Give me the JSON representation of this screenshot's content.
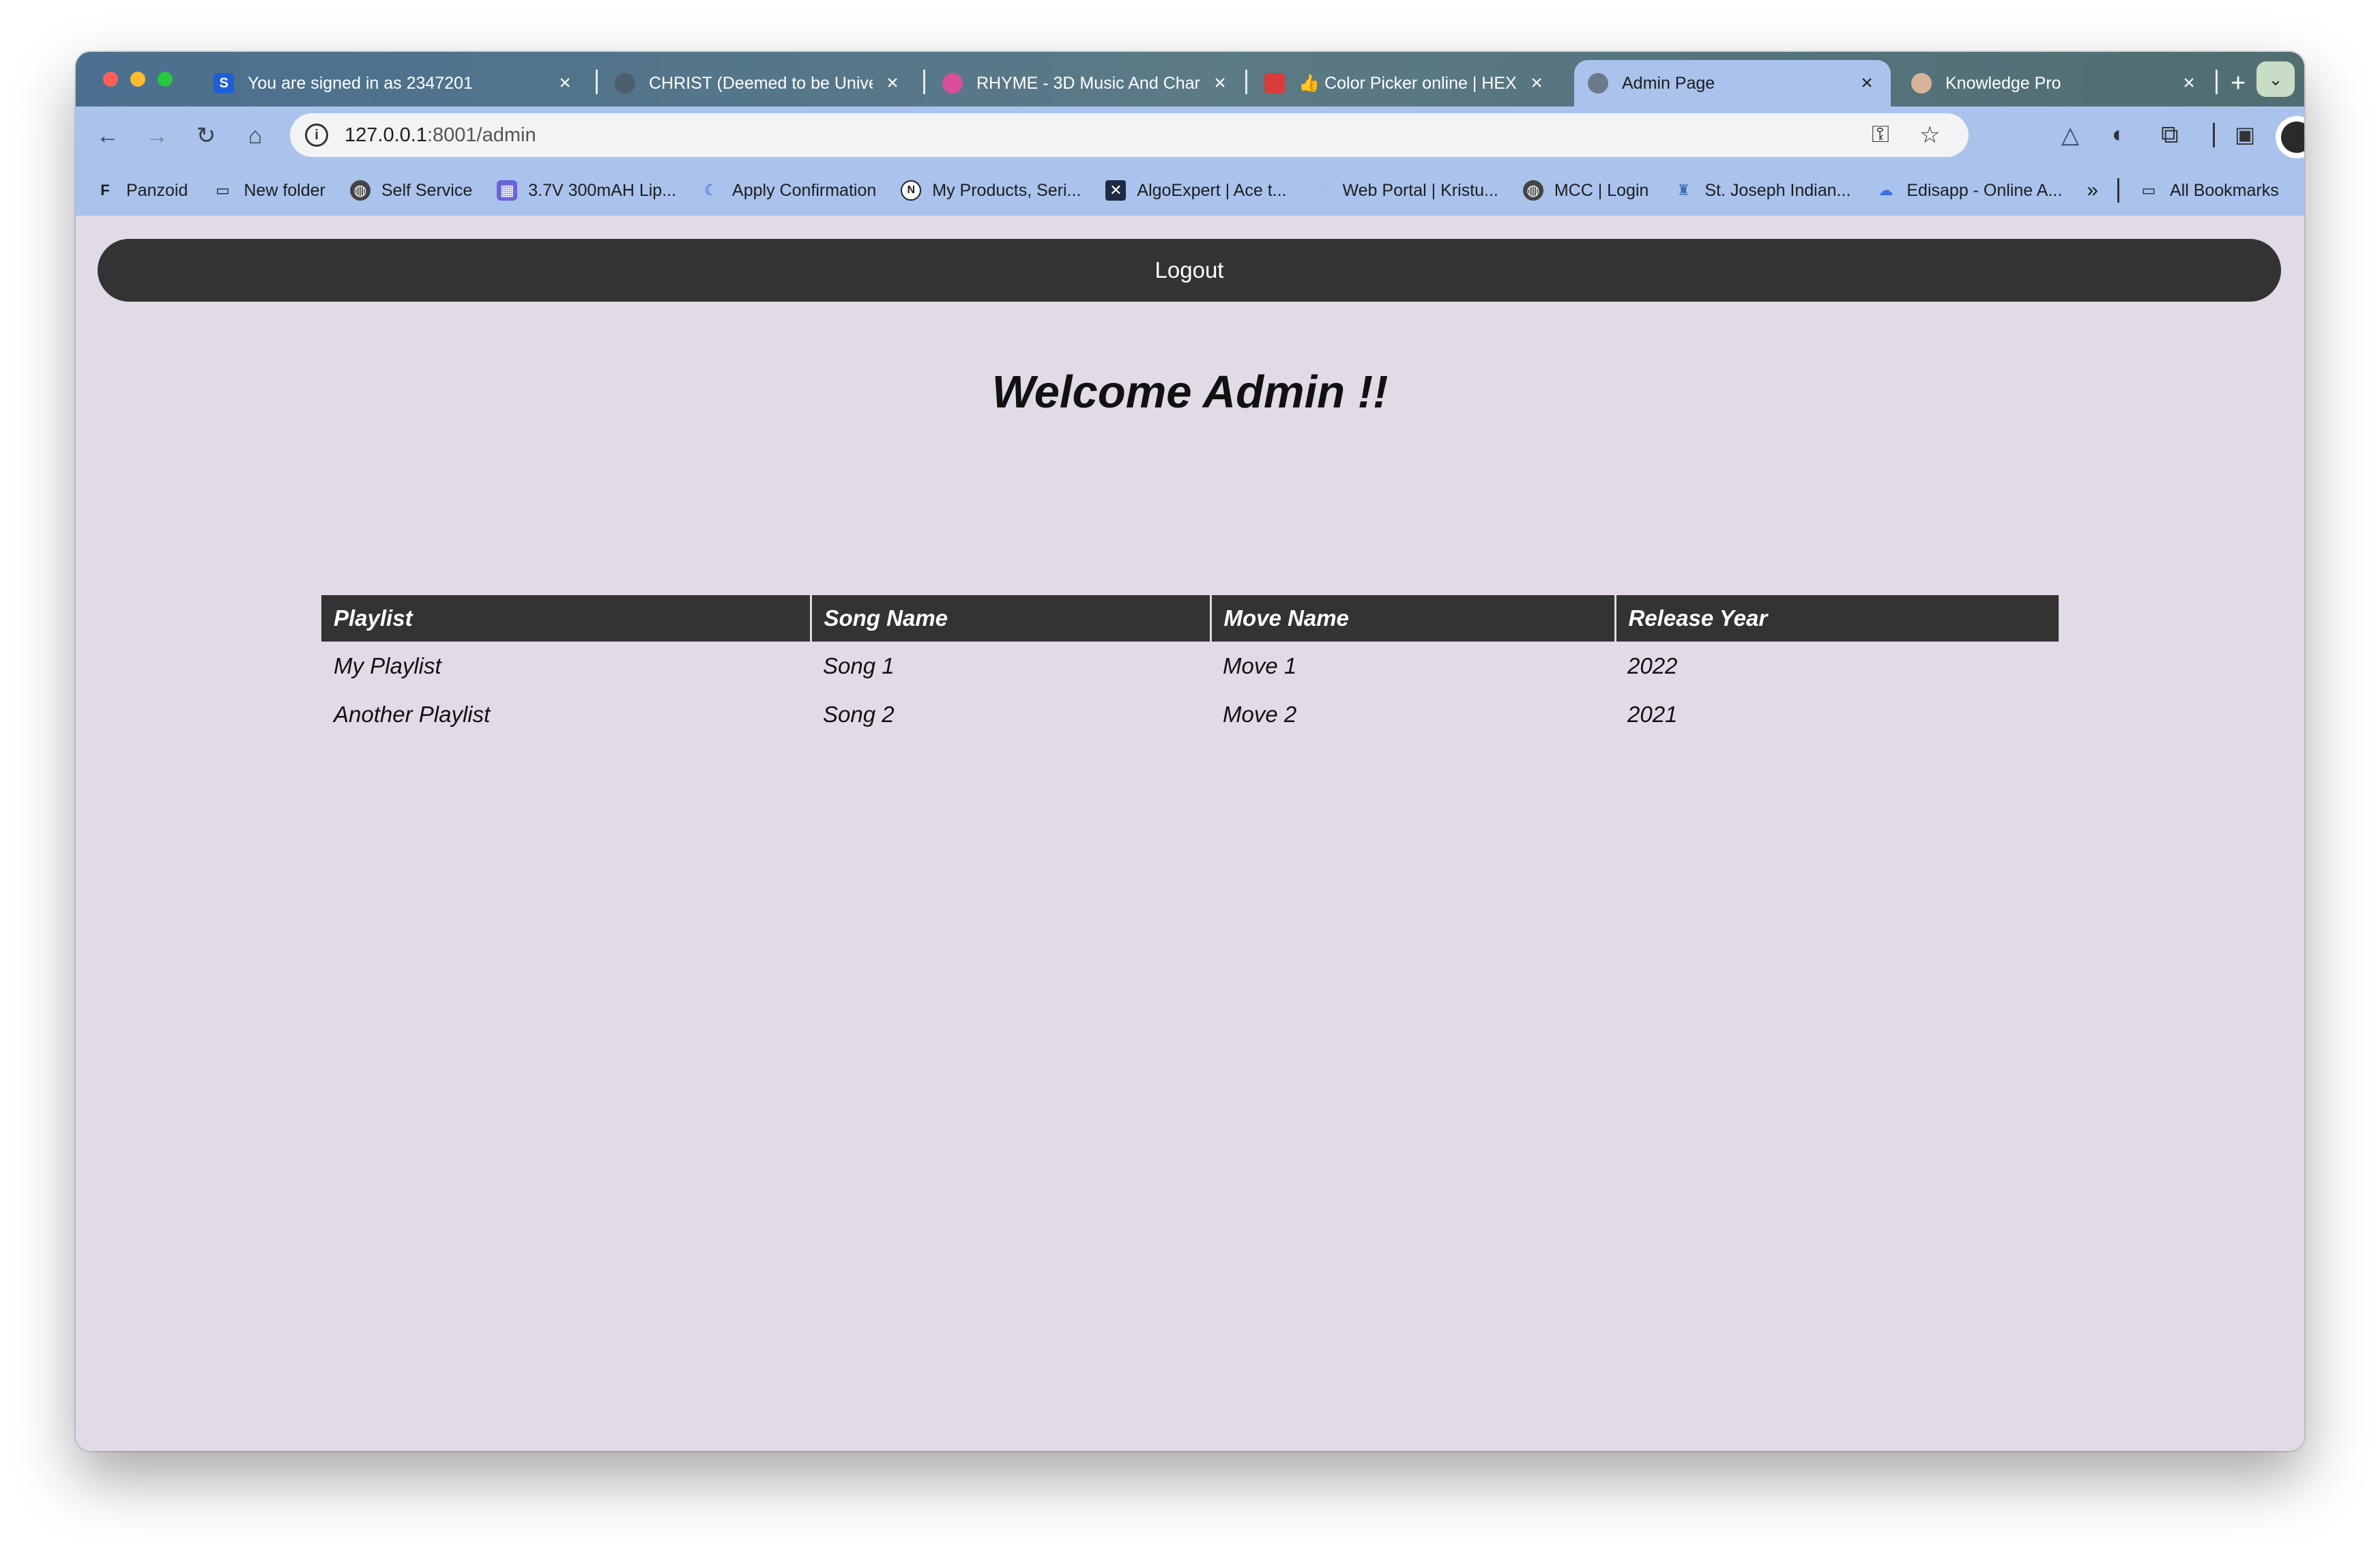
{
  "tabs": [
    {
      "favicon": "S",
      "favicon_color": "#1d5fd6",
      "title": "You are signed in as 2347201"
    },
    {
      "favicon": "",
      "favicon_color": "#4b5f6e",
      "title": "CHRIST (Deemed to be Unive"
    },
    {
      "favicon": "",
      "favicon_color": "#d94f9a",
      "title": "RHYME - 3D Music And Char"
    },
    {
      "favicon": "",
      "favicon_color": "#d93a3a",
      "title": "👍 Color Picker online | HEX C"
    },
    {
      "favicon": "",
      "favicon_color": "#6b7a8a",
      "title": "Admin Page"
    },
    {
      "favicon": "",
      "favicon_color": "#d8b59a",
      "title": "Knowledge Pro"
    }
  ],
  "toolbar": {
    "url_host": "127.0.0.1",
    "url_rest": ":8001/admin"
  },
  "bookmarks": [
    {
      "icon": "panzoid-icon",
      "label": "Panzoid"
    },
    {
      "icon": "folder-icon",
      "label": "New folder"
    },
    {
      "icon": "globe-icon",
      "label": "Self Service"
    },
    {
      "icon": "cube-icon",
      "label": "3.7V 300mAH Lip..."
    },
    {
      "icon": "k-icon",
      "label": "Apply Confirmation"
    },
    {
      "icon": "n-icon",
      "label": "My Products, Seri..."
    },
    {
      "icon": "algoexpert-icon",
      "label": "AlgoExpert | Ace t..."
    },
    {
      "icon": "portal-icon",
      "label": "Web Portal | Kristu..."
    },
    {
      "icon": "globe-icon",
      "label": "MCC | Login"
    },
    {
      "icon": "school-icon",
      "label": "St. Joseph Indian..."
    },
    {
      "icon": "edisapp-icon",
      "label": "Edisapp - Online A..."
    }
  ],
  "all_bookmarks_label": "All Bookmarks",
  "page": {
    "logout_label": "Logout",
    "welcome": "Welcome Admin !!",
    "table": {
      "headers": [
        "Playlist",
        "Song Name",
        "Move Name",
        "Release Year"
      ],
      "rows": [
        [
          "My Playlist",
          "Song 1",
          "Move 1",
          "2022"
        ],
        [
          "Another Playlist",
          "Song 2",
          "Move 2",
          "2021"
        ]
      ]
    }
  }
}
